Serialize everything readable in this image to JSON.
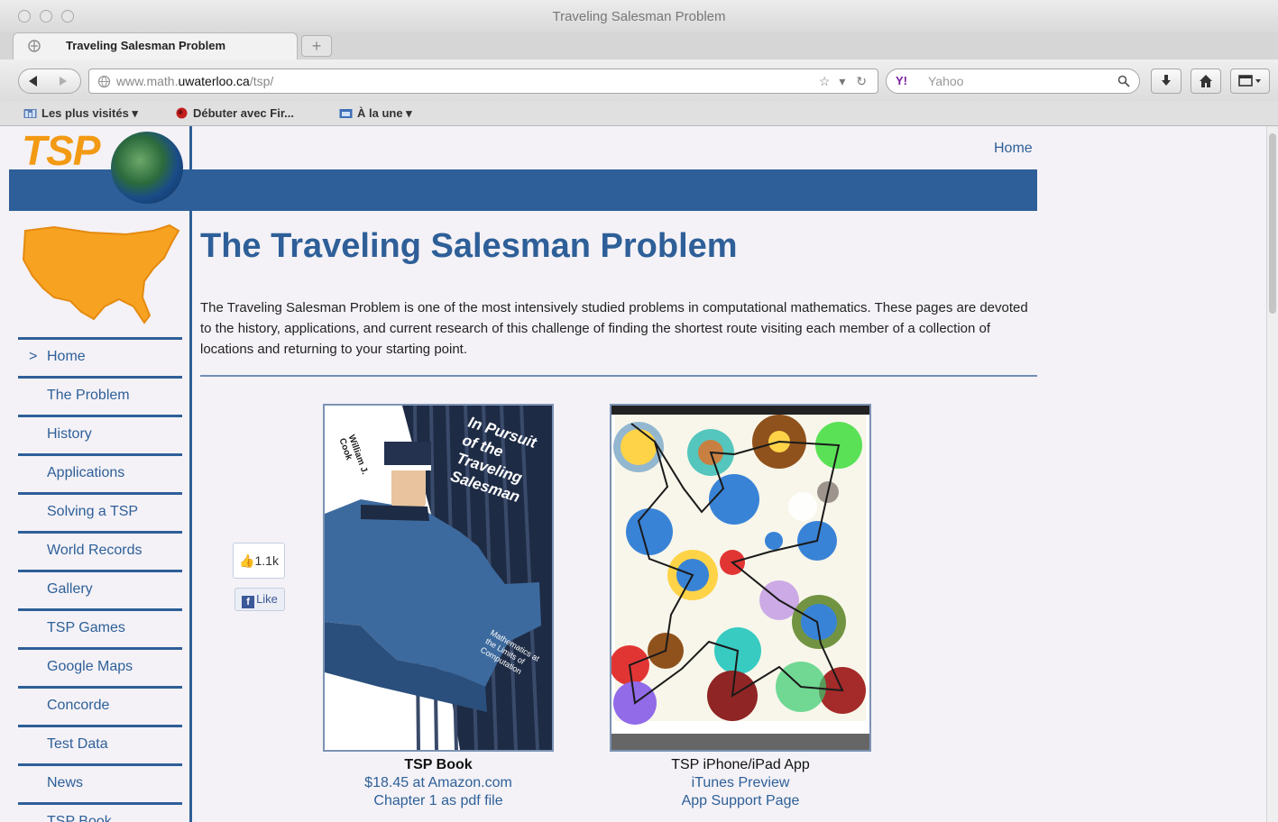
{
  "window": {
    "title": "Traveling Salesman Problem"
  },
  "tab": {
    "title": "Traveling Salesman Problem",
    "new_tab": "+"
  },
  "toolbar": {
    "url_domain_prefix": "www.math.",
    "url_domain": "uwaterloo.ca",
    "url_path": "/tsp/",
    "search_placeholder": "Yahoo",
    "search_engine": "Y!"
  },
  "bookmarks": [
    {
      "label": "Les plus visités ▾",
      "icon": "folder-icon"
    },
    {
      "label": "Débuter avec Fir...",
      "icon": "firefox-icon"
    },
    {
      "label": "À la une ▾",
      "icon": "rss-folder-icon"
    }
  ],
  "site": {
    "logo_text": "TSP",
    "top_link": "Home",
    "sidebar_marker": ">",
    "sidebar": [
      "Home",
      "The Problem",
      "History",
      "Applications",
      "Solving a TSP",
      "World Records",
      "Gallery",
      "TSP Games",
      "Google Maps",
      "Concorde",
      "Test Data",
      "News",
      "TSP Book"
    ],
    "title": "The Traveling Salesman Problem",
    "intro": "The Traveling Salesman Problem is one of the most intensively studied problems in computational mathematics. These pages are devoted to the history, applications, and current research of this challenge of finding the shortest route visiting each member of a collection of locations and returning to your starting point.",
    "book": {
      "caption": "TSP Book",
      "link1": "$18.45 at Amazon.com",
      "link2": "Chapter 1 as pdf file",
      "cover_title": "In Pursuit of the Traveling Salesman",
      "author": "William J. Cook",
      "subtitle": "Mathematics at the Limits of Computation"
    },
    "app": {
      "caption": "TSP iPhone/iPad App",
      "link1": "iTunes Preview",
      "link2": "App Support Page"
    },
    "facebook": {
      "count": "1.1k",
      "like": "Like"
    }
  }
}
